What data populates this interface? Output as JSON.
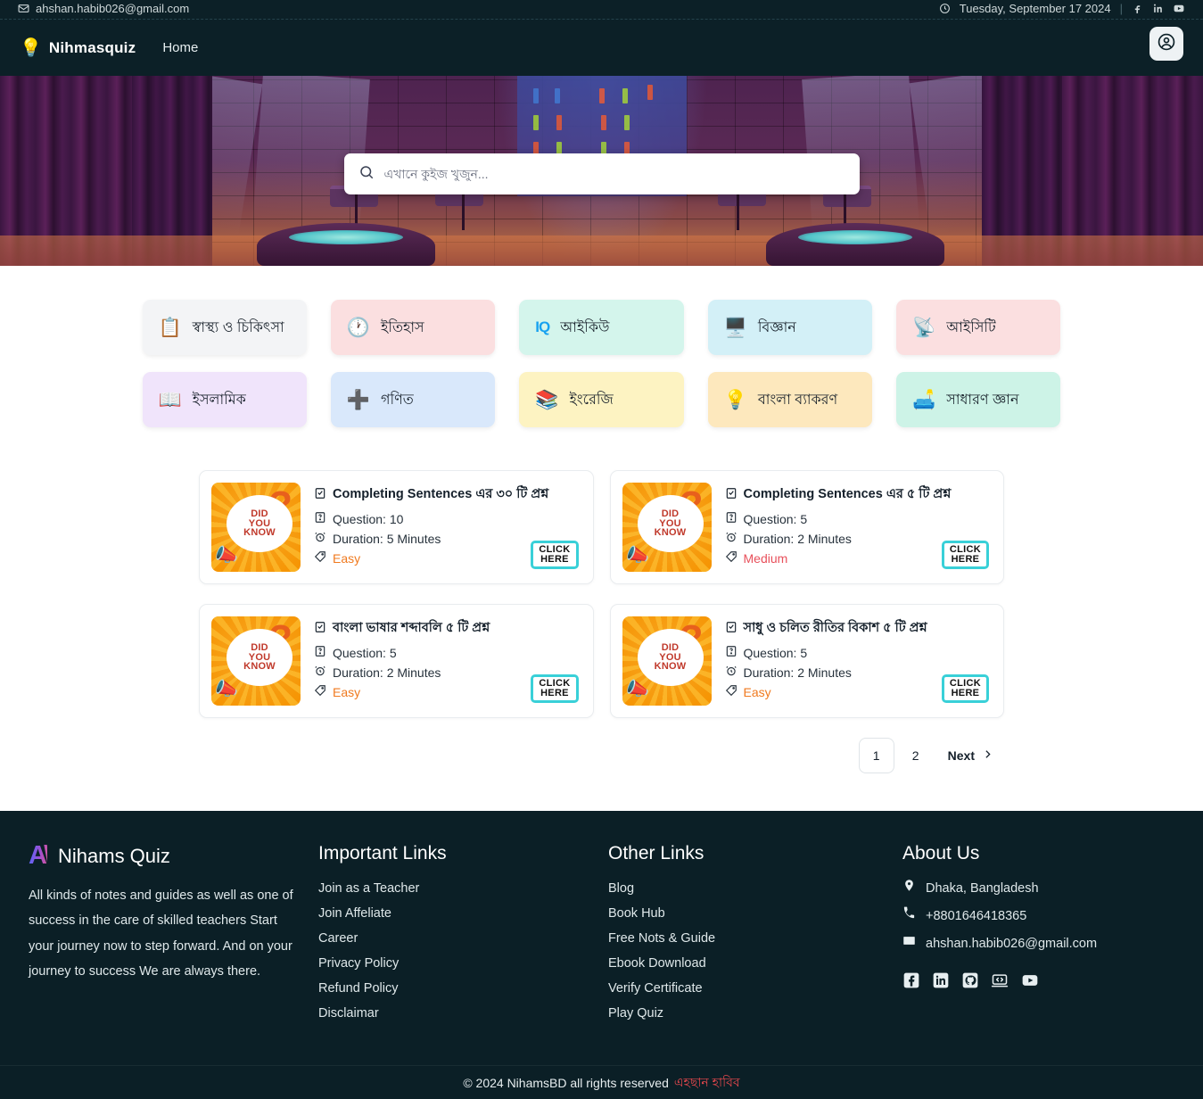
{
  "topbar": {
    "email": "ahshan.habib026@gmail.com",
    "date": "Tuesday, September 17 2024",
    "separator": "|",
    "socials": [
      "facebook-icon",
      "linkedin-icon",
      "youtube-icon"
    ]
  },
  "navbar": {
    "brand": "Nihmasquiz",
    "logo_icon": "lightbulb-question-icon",
    "links": [
      {
        "label": "Home"
      }
    ],
    "account_icon": "user-circle-icon"
  },
  "hero": {
    "search": {
      "placeholder": "এখানে কুইজ খুজুন...",
      "value": "",
      "icon": "search-icon"
    }
  },
  "categories": [
    {
      "label": "স্বাস্থ্য ও চিকিৎসা",
      "icon": "medical-report-icon",
      "bg": "#f3f4f6"
    },
    {
      "label": "ইতিহাস",
      "icon": "history-clock-icon",
      "bg": "#fbdfe0"
    },
    {
      "label": "আইকিউ",
      "icon": "iq-icon",
      "bg": "#d4f5ec"
    },
    {
      "label": "বিজ্ঞান",
      "icon": "science-monitor-icon",
      "bg": "#d3f0f7"
    },
    {
      "label": "আইসিটি",
      "icon": "antenna-tower-icon",
      "bg": "#fbdfe0"
    },
    {
      "label": "ইসলামিক",
      "icon": "quran-book-icon",
      "bg": "#f0e4fb"
    },
    {
      "label": "গণিত",
      "icon": "math-symbols-icon",
      "bg": "#d9e8fb"
    },
    {
      "label": "ইংরেজি",
      "icon": "english-book-icon",
      "bg": "#fdf3c2"
    },
    {
      "label": "বাংলা ব্যাকরণ",
      "icon": "idea-book-icon",
      "bg": "#fde8bd"
    },
    {
      "label": "সাধারণ জ্ঞান",
      "icon": "desk-lamp-books-icon",
      "bg": "#cdf3e7"
    }
  ],
  "quizzes": [
    {
      "title": "Completing Sentences এর ৩০ টি প্রশ্ন",
      "question_label": "Question: 10",
      "duration_label": "Duration: 5 Minutes",
      "difficulty": "Easy",
      "difficulty_class": "tag-easy",
      "thumb": {
        "line1": "DID",
        "line2": "YOU",
        "line3": "KNOW",
        "qmark": "?"
      },
      "cta_line1": "CLICK",
      "cta_line2": "HERE"
    },
    {
      "title": "Completing Sentences এর ৫ টি প্রশ্ন",
      "question_label": "Question: 5",
      "duration_label": "Duration: 2 Minutes",
      "difficulty": "Medium",
      "difficulty_class": "tag-medium",
      "thumb": {
        "line1": "DID",
        "line2": "YOU",
        "line3": "KNOW",
        "qmark": "?"
      },
      "cta_line1": "CLICK",
      "cta_line2": "HERE"
    },
    {
      "title": "বাংলা ভাষার শব্দাবলি ৫ টি প্রশ্ন",
      "question_label": "Question: 5",
      "duration_label": "Duration: 2 Minutes",
      "difficulty": "Easy",
      "difficulty_class": "tag-easy",
      "thumb": {
        "line1": "DID",
        "line2": "YOU",
        "line3": "KNOW",
        "qmark": "?"
      },
      "cta_line1": "CLICK",
      "cta_line2": "HERE"
    },
    {
      "title": "সাধু ও চলিত রীতির বিকাশ ৫ টি প্রশ্ন",
      "question_label": "Question: 5",
      "duration_label": "Duration: 2 Minutes",
      "difficulty": "Easy",
      "difficulty_class": "tag-easy",
      "thumb": {
        "line1": "DID",
        "line2": "YOU",
        "line3": "KNOW",
        "qmark": "?"
      },
      "cta_line1": "CLICK",
      "cta_line2": "HERE"
    }
  ],
  "pagination": {
    "pages": [
      "1",
      "2"
    ],
    "active": "1",
    "next_label": "Next",
    "next_icon": "chevron-right-icon"
  },
  "footer": {
    "brand": {
      "mark": "A\\",
      "name": "Nihams Quiz"
    },
    "description": "All kinds of notes and guides as well as one of success in the care of skilled teachers Start your journey now to step forward. And on your journey to success We are always there.",
    "columns": [
      {
        "heading": "Important Links",
        "links": [
          "Join as a Teacher",
          "Join Affeliate",
          "Career",
          "Privacy Policy",
          "Refund Policy",
          "Disclaimar"
        ]
      },
      {
        "heading": "Other Links",
        "links": [
          "Blog",
          "Book Hub",
          "Free Nots & Guide",
          "Ebook Download",
          "Verify Certificate",
          "Play Quiz"
        ]
      }
    ],
    "about": {
      "heading": "About Us",
      "address": "Dhaka, Bangladesh",
      "phone": "+8801646418365",
      "email": "ahshan.habib026@gmail.com",
      "socials": [
        "facebook-icon",
        "linkedin-icon",
        "github-icon",
        "code-laptop-icon",
        "youtube-icon"
      ]
    }
  },
  "copyright": {
    "text": "© 2024 NihamsBD all rights reserved",
    "author": "এহছান হাবিব"
  }
}
